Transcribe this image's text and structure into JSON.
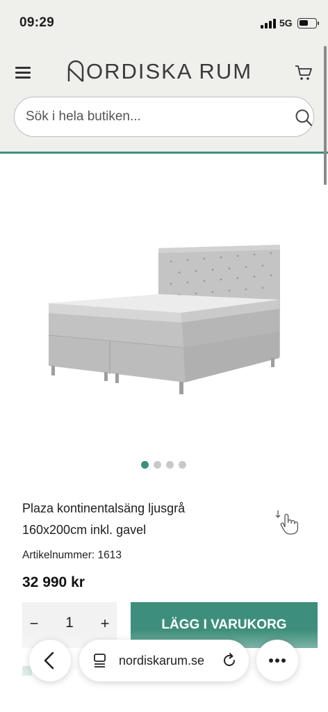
{
  "status_bar": {
    "time": "09:29",
    "network": "5G"
  },
  "header": {
    "logo_text": "ORDISKA RUM",
    "search": {
      "placeholder": "Sök i hela butiken..."
    }
  },
  "gallery": {
    "image_count": 4,
    "active_index": 0
  },
  "product": {
    "title_line1": "Plaza kontinentalsäng ljusgrå",
    "title_line2": "160x200cm inkl. gavel",
    "sku": "Artikelnummer: 1613",
    "price": "32 990 kr"
  },
  "purchase": {
    "minus": "−",
    "quantity": "1",
    "plus": "+",
    "add_to_cart": "LÄGG I VARUKORG"
  },
  "browser": {
    "url": "nordiskarum.se"
  },
  "colors": {
    "accent": "#3e8e7c",
    "header_bg": "#efefec"
  }
}
